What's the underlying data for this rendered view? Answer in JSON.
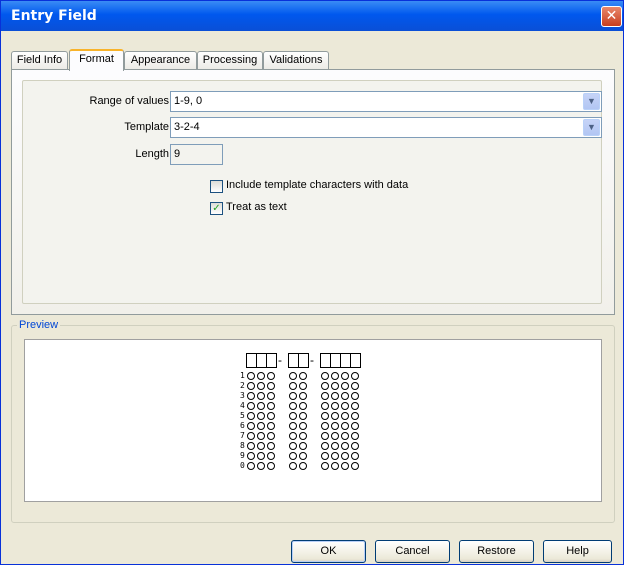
{
  "window": {
    "title": "Entry Field",
    "close_label": "✕"
  },
  "tabs": [
    {
      "label": "Field Info",
      "active": false
    },
    {
      "label": "Format",
      "active": true
    },
    {
      "label": "Appearance",
      "active": false
    },
    {
      "label": "Processing",
      "active": false
    },
    {
      "label": "Validations",
      "active": false
    }
  ],
  "format": {
    "range_label": "Range of values",
    "range_value": "1-9, 0",
    "template_label": "Template",
    "template_value": "3-2-4",
    "length_label": "Length",
    "length_value": "9",
    "include_template_label": "Include template characters with data",
    "include_template_checked": false,
    "treat_as_text_label": "Treat as text",
    "treat_as_text_checked": true
  },
  "preview": {
    "label": "Preview",
    "template_groups": [
      3,
      2,
      4
    ],
    "separator": "-",
    "row_labels": [
      "1",
      "2",
      "3",
      "4",
      "5",
      "6",
      "7",
      "8",
      "9",
      "0"
    ]
  },
  "buttons": {
    "ok": "OK",
    "cancel": "Cancel",
    "restore": "Restore",
    "help": "Help"
  },
  "colors": {
    "title_bar": "#0058ee",
    "active_tab_accent": "#f8b32a",
    "preview_label": "#0046d5"
  }
}
